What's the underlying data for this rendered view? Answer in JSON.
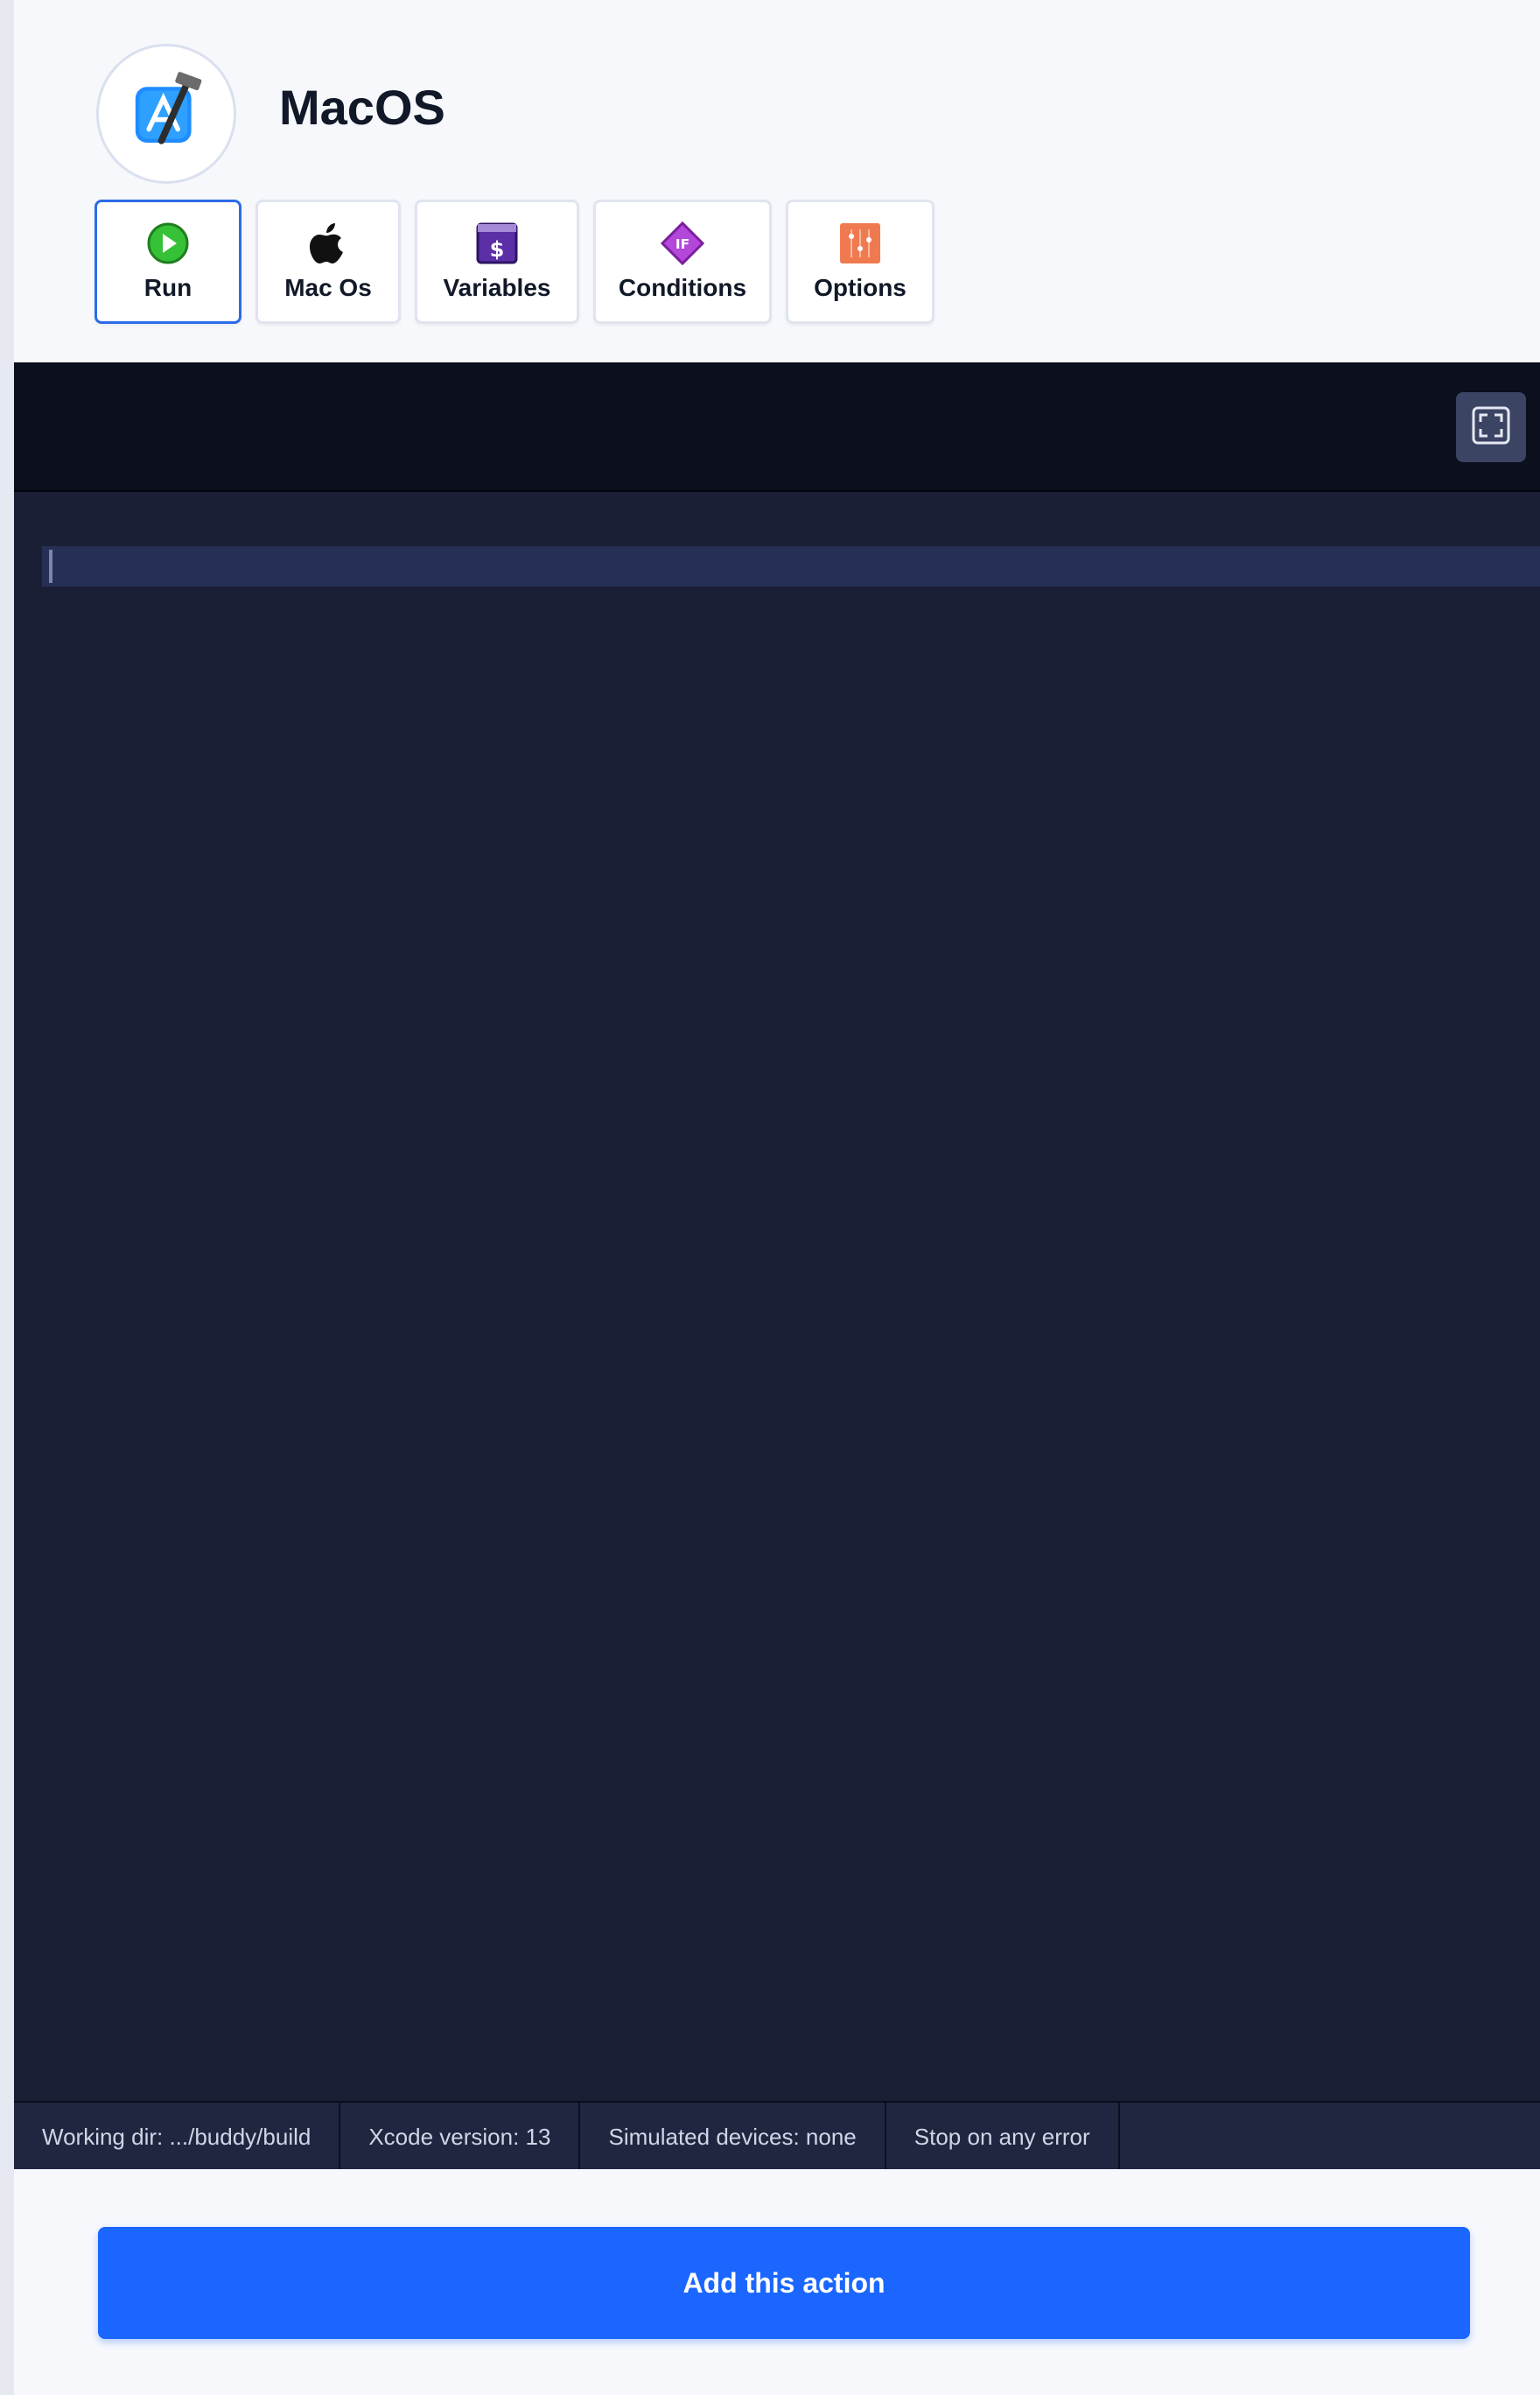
{
  "header": {
    "title": "MacOS",
    "app_icon": "xcode-hammer-gear-icon"
  },
  "tabs": [
    {
      "label": "Run",
      "icon": "play-circle-icon",
      "active": true,
      "color": "#36c136"
    },
    {
      "label": "Mac Os",
      "icon": "apple-logo-icon",
      "active": false,
      "color": "#111111"
    },
    {
      "label": "Variables",
      "icon": "dollar-window-icon",
      "active": false,
      "color": "#5b2fa6"
    },
    {
      "label": "Conditions",
      "icon": "if-diamond-icon",
      "active": false,
      "color": "#b347d9"
    },
    {
      "label": "Options",
      "icon": "sliders-icon",
      "active": false,
      "color": "#f07a50"
    }
  ],
  "editor": {
    "fullscreen_icon": "fullscreen-icon",
    "content": ""
  },
  "status_bar": {
    "working_dir": "Working dir: .../buddy/build",
    "xcode_version": "Xcode version: 13",
    "simulated_devices": "Simulated devices: none",
    "stop_on_error": "Stop on any error"
  },
  "actions": {
    "add_label": "Add this action"
  },
  "colors": {
    "primary": "#1a66ff",
    "active_tab_border": "#2d6ce8",
    "editor_bg": "#1b1f35",
    "editor_toolbar_bg": "#0b0f1e"
  }
}
